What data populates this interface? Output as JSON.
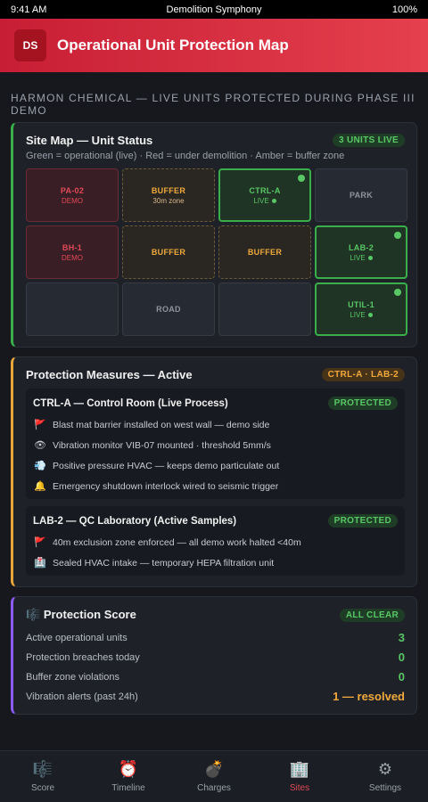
{
  "status": {
    "time": "9:41 AM",
    "title": "Demolition Symphony",
    "battery": "100%"
  },
  "header": {
    "logo": "DS",
    "title": "Operational Unit Protection Map"
  },
  "subtitle": "HARMON CHEMICAL — LIVE UNITS PROTECTED DURING PHASE III DEMO",
  "site_map": {
    "title": "Site Map — Unit Status",
    "badge": "3 UNITS LIVE",
    "legend": "Green = operational (live) · Red = under demolition · Amber = buffer zone",
    "cells": [
      {
        "name": "PA-02",
        "sub": "DEMO",
        "state": "demo"
      },
      {
        "name": "BUFFER",
        "sub": "30m zone",
        "state": "buffer"
      },
      {
        "name": "CTRL-A",
        "sub": "LIVE",
        "state": "live"
      },
      {
        "name": "PARK",
        "sub": "",
        "state": "plain"
      },
      {
        "name": "BH-1",
        "sub": "DEMO",
        "state": "demo"
      },
      {
        "name": "BUFFER",
        "sub": "",
        "state": "buffer"
      },
      {
        "name": "BUFFER",
        "sub": "",
        "state": "buffer"
      },
      {
        "name": "LAB-2",
        "sub": "LIVE",
        "state": "live"
      },
      {
        "name": "",
        "sub": "",
        "state": "plain"
      },
      {
        "name": "ROAD",
        "sub": "",
        "state": "plain"
      },
      {
        "name": "",
        "sub": "",
        "state": "plain"
      },
      {
        "name": "UTIL-1",
        "sub": "LIVE",
        "state": "live"
      }
    ]
  },
  "protection": {
    "title": "Protection Measures — Active",
    "badge": "CTRL-A · LAB-2",
    "units": [
      {
        "title": "CTRL-A — Control Room (Live Process)",
        "badge": "PROTECTED",
        "measures": [
          {
            "icon": "🚩",
            "icon_name": "flag-icon",
            "text": "Blast mat barrier installed on west wall — demo side"
          },
          {
            "icon": "👁",
            "icon_name": "eye-icon",
            "text": "Vibration monitor VIB-07 mounted · threshold 5mm/s"
          },
          {
            "icon": "💨",
            "icon_name": "air-icon",
            "text": "Positive pressure HVAC — keeps demo particulate out"
          },
          {
            "icon": "🔔",
            "icon_name": "bell-icon",
            "text": "Emergency shutdown interlock wired to seismic trigger"
          }
        ]
      },
      {
        "title": "LAB-2 — QC Laboratory (Active Samples)",
        "badge": "PROTECTED",
        "measures": [
          {
            "icon": "🚩",
            "icon_name": "flag-icon",
            "text": "40m exclusion zone enforced — all demo work halted <40m"
          },
          {
            "icon": "🏥",
            "icon_name": "hospital-icon",
            "text": "Sealed HVAC intake — temporary HEPA filtration unit"
          }
        ]
      }
    ]
  },
  "score": {
    "icon": "🎼",
    "title": "Protection Score",
    "badge": "ALL CLEAR",
    "rows": [
      {
        "label": "Active operational units",
        "value": "3",
        "warn": false
      },
      {
        "label": "Protection breaches today",
        "value": "0",
        "warn": false
      },
      {
        "label": "Buffer zone violations",
        "value": "0",
        "warn": false
      },
      {
        "label": "Vibration alerts (past 24h)",
        "value": "1 — resolved",
        "warn": true
      }
    ]
  },
  "tabs": [
    {
      "label": "Score",
      "icon": "🎼",
      "icon_name": "score-icon",
      "active": false
    },
    {
      "label": "Timeline",
      "icon": "⏰",
      "icon_name": "alarm-clock-icon",
      "active": false
    },
    {
      "label": "Charges",
      "icon": "💣",
      "icon_name": "bomb-icon",
      "active": false
    },
    {
      "label": "Sites",
      "icon": "🏢",
      "icon_name": "building-icon",
      "active": true
    },
    {
      "label": "Settings",
      "icon": "⚙",
      "icon_name": "gear-icon",
      "active": false
    }
  ],
  "colors": {
    "accent": "#e5404d",
    "live": "#59c766",
    "buffer": "#f0a93c",
    "demo": "#e04a58"
  }
}
